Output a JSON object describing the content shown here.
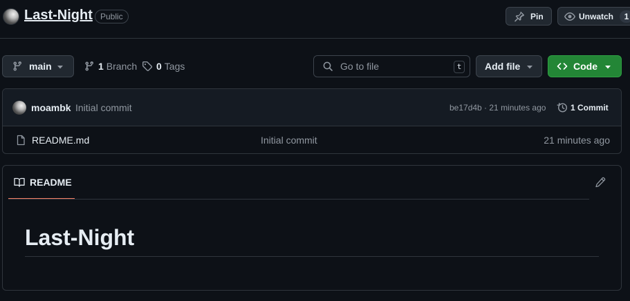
{
  "repo": {
    "name": "Last-Night",
    "visibility": "Public"
  },
  "header_actions": {
    "pin_label": "Pin",
    "watch_label": "Unwatch",
    "watch_count": "1"
  },
  "toolbar": {
    "branch": "main",
    "branches_count": "1",
    "branches_label": "Branch",
    "tags_count": "0",
    "tags_label": "Tags",
    "search_placeholder": "Go to file",
    "search_shortcut": "t",
    "add_file_label": "Add file",
    "code_label": "Code"
  },
  "latest_commit": {
    "author": "moambk",
    "message": "Initial commit",
    "sha_and_time": "be17d4b · 21 minutes ago",
    "commit_count": "1 Commit"
  },
  "files": [
    {
      "name": "README.md",
      "commit_message": "Initial commit",
      "time": "21 minutes ago"
    }
  ],
  "readme": {
    "tab_label": "README",
    "title": "Last-Night"
  },
  "colors": {
    "background": "#0d1117",
    "border": "#30363d",
    "primary_green": "#238636",
    "active_tab_accent": "#f78166"
  },
  "icons": [
    "pin-icon",
    "eye-icon",
    "git-branch-icon",
    "tag-icon",
    "search-icon",
    "code-icon",
    "history-icon",
    "file-icon",
    "book-icon",
    "pencil-icon",
    "triangle-down-icon"
  ]
}
